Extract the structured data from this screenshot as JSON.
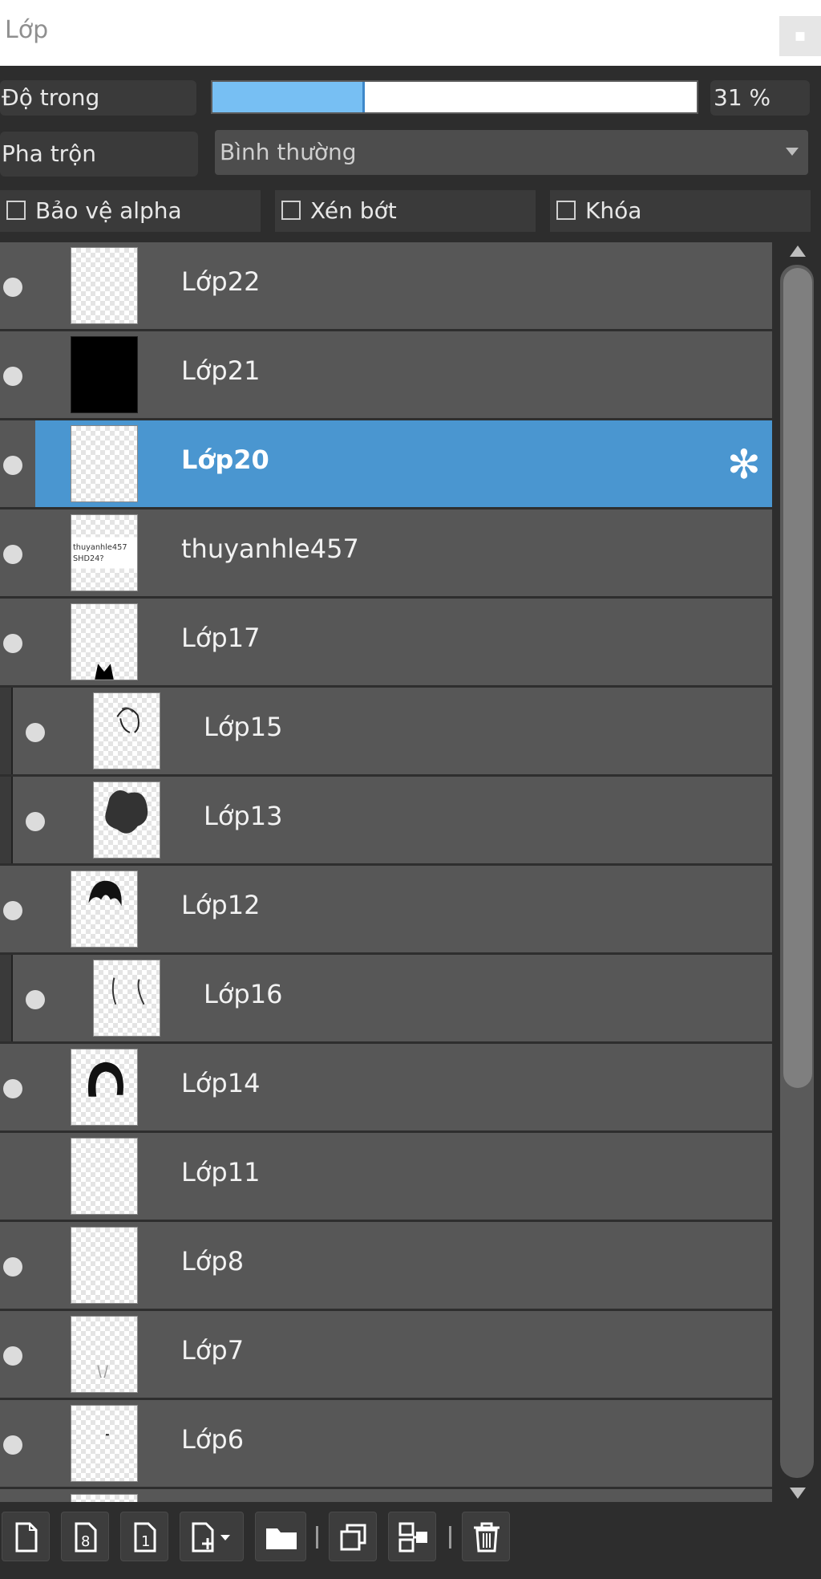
{
  "panel": {
    "title": "Lớp"
  },
  "controls": {
    "opacity_label": "Độ trong",
    "opacity_value": "31 %",
    "opacity_fraction": 0.31,
    "blend_label": "Pha trộn",
    "blend_value": "Bình thường",
    "protect_alpha_label": "Bảo vệ alpha",
    "clipping_label": "Xén bớt",
    "lock_label": "Khóa"
  },
  "layers": [
    {
      "name": "Lớp22",
      "visible": true,
      "indent": false,
      "selected": false,
      "thumb": "blank"
    },
    {
      "name": "Lớp21",
      "visible": true,
      "indent": false,
      "selected": false,
      "thumb": "black"
    },
    {
      "name": "Lớp20",
      "visible": true,
      "indent": false,
      "selected": true,
      "thumb": "blank"
    },
    {
      "name": "thuyanhle457",
      "visible": true,
      "indent": false,
      "selected": false,
      "thumb": "text"
    },
    {
      "name": "Lớp17",
      "visible": true,
      "indent": false,
      "selected": false,
      "thumb": "ears"
    },
    {
      "name": "Lớp15",
      "visible": true,
      "indent": true,
      "selected": false,
      "thumb": "sketch"
    },
    {
      "name": "Lớp13",
      "visible": true,
      "indent": true,
      "selected": false,
      "thumb": "blob"
    },
    {
      "name": "Lớp12",
      "visible": true,
      "indent": false,
      "selected": false,
      "thumb": "bangs"
    },
    {
      "name": "Lớp16",
      "visible": true,
      "indent": true,
      "selected": false,
      "thumb": "lines"
    },
    {
      "name": "Lớp14",
      "visible": true,
      "indent": false,
      "selected": false,
      "thumb": "hair"
    },
    {
      "name": "Lớp11",
      "visible": false,
      "indent": false,
      "selected": false,
      "thumb": "blank"
    },
    {
      "name": "Lớp8",
      "visible": true,
      "indent": false,
      "selected": false,
      "thumb": "blank"
    },
    {
      "name": "Lớp7",
      "visible": true,
      "indent": false,
      "selected": false,
      "thumb": "faint"
    },
    {
      "name": "Lớp6",
      "visible": true,
      "indent": false,
      "selected": false,
      "thumb": "dot"
    }
  ],
  "toolbar": {
    "buttons": [
      "new-layer-icon",
      "new-halftone-layer-icon",
      "new-1bit-layer-icon",
      "add-layer-dropdown-icon",
      "folder-icon",
      "duplicate-layer-icon",
      "merge-down-icon",
      "trash-icon"
    ]
  },
  "colors": {
    "selection": "#4a96d0",
    "opacity_fill": "#77bff3",
    "row": "#575757"
  }
}
